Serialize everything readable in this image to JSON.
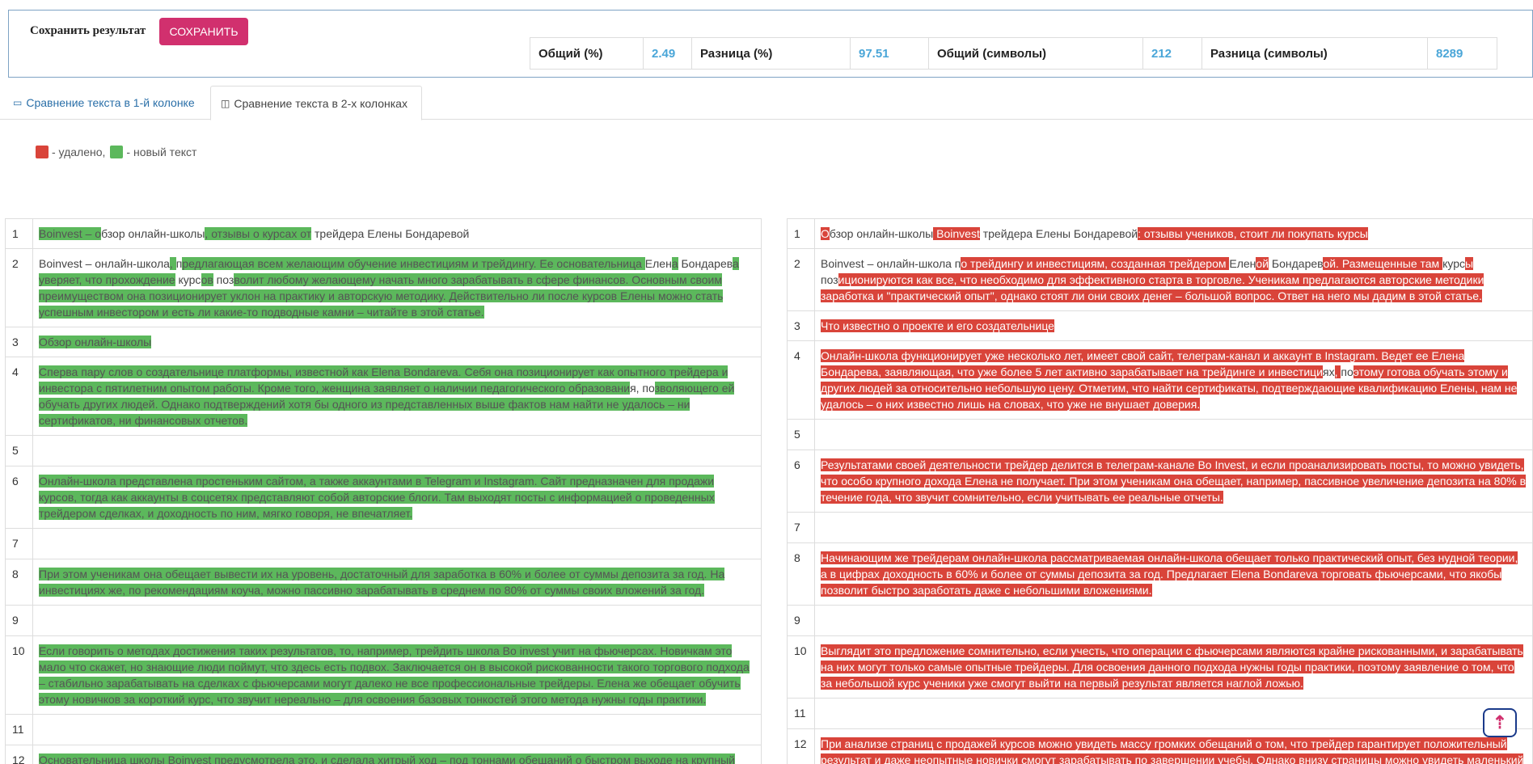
{
  "header": {
    "save_label": "Сохранить результат",
    "save_button": "СОХРАНИТЬ"
  },
  "stats": [
    {
      "label": "Общий (%)",
      "value": "2.49"
    },
    {
      "label": "Разница (%)",
      "value": "97.51"
    },
    {
      "label": "Общий (символы)",
      "value": "212"
    },
    {
      "label": "Разница (символы)",
      "value": "8289"
    }
  ],
  "tabs": {
    "one_col": "Сравнение текста в 1-й колонке",
    "two_col": "Сравнение текста в 2-х колонках"
  },
  "legend": {
    "deleted": "- удалено,",
    "new": "- новый текст"
  },
  "colors": {
    "deleted": "#d9443a",
    "new": "#5cb85c",
    "accent": "#d1306e"
  },
  "left_rows": [
    {
      "n": "1",
      "segs": [
        [
          "g",
          "Boinvest – о"
        ],
        [
          "n",
          "бзор онлайн-школы"
        ],
        [
          "g",
          ", отзывы о курсах от"
        ],
        [
          "n",
          " трейдера Елены Бондаревой"
        ]
      ]
    },
    {
      "n": "2",
      "segs": [
        [
          "n",
          "Boinvest – онлайн-школа"
        ],
        [
          "g",
          ", "
        ],
        [
          "n",
          "п"
        ],
        [
          "g",
          "редлагающая всем желающим обучение инвестициям и трейдингу. Ее основательница "
        ],
        [
          "n",
          "Елен"
        ],
        [
          "g",
          "а"
        ],
        [
          "n",
          " Бондарев"
        ],
        [
          "g",
          "а уверяет, что прохождение"
        ],
        [
          "n",
          " курс"
        ],
        [
          "g",
          "ов"
        ],
        [
          "n",
          " поз"
        ],
        [
          "g",
          "волит любому желающему начать много зарабатывать в сфере финансов. Основным своим преимуществом она позиционирует уклон на практику и авторскую методику. Действительно ли после курсов Елены можно стать успешным инвестором и есть ли какие-то подводные камни – читайте в этой статье."
        ]
      ]
    },
    {
      "n": "3",
      "segs": [
        [
          "g",
          "Обзор онлайн-школы"
        ]
      ]
    },
    {
      "n": "4",
      "segs": [
        [
          "g",
          "Сперва пару слов о создательнице платформы, известной как Elena Bondareva. Себя она позиционирует как опытного трейдера и инвестора с пятилетним опытом работы. Кроме того, женщина заявляет о наличии педагогического образовани"
        ],
        [
          "n",
          "я, по"
        ],
        [
          "g",
          "зволяющего ей обучать других людей. Однако подтверждений хотя бы одного из представленных выше фактов нам найти не удалось – ни сертификатов, ни финансовых отчетов."
        ]
      ]
    },
    {
      "n": "5",
      "segs": []
    },
    {
      "n": "6",
      "segs": [
        [
          "g",
          "Онлайн-школа представлена простеньким сайтом, а также аккаунтами в Telegram и Instagram. Сайт предназначен для продажи курсов, тогда как аккаунты в соцсетях представляют собой авторские блоги. Там выходят посты с информацией о проведенных трейдером сделках, и доходность по ним, мягко говоря, не впечатляет."
        ]
      ]
    },
    {
      "n": "7",
      "segs": []
    },
    {
      "n": "8",
      "segs": [
        [
          "g",
          "При этом ученикам она обещает вывести их на уровень, достаточный для заработка в 60% и более от суммы депозита за год. На инвестициях же, по рекомендациям коуча, можно пассивно зарабатывать в среднем по 80% от суммы своих вложений за год."
        ]
      ]
    },
    {
      "n": "9",
      "segs": []
    },
    {
      "n": "10",
      "segs": [
        [
          "g",
          "Если говорить о методах достижения таких результатов, то, например, трейдить школа Bo invest учит на фьючерсах. Новичкам это мало что скажет, но знающие люди поймут, что здесь есть подвох. Заключается он в высокой рискованности такого торгового подхода – стабильно зарабатывать на сделках с фьючерсами могут далеко не все профессиональные трейдеры. Елена же обещает обучить этому новичков за короткий курс, что звучит нереально – для освоения базовых тонкостей этого метода нужны годы практики."
        ]
      ]
    },
    {
      "n": "11",
      "segs": []
    },
    {
      "n": "12",
      "segs": [
        [
          "g",
          "Основательница школы Boinvest предусмотрела это, и сделала хитрый ход – под тоннами обещаний о быстром выходе на крупный"
        ]
      ]
    }
  ],
  "right_rows": [
    {
      "n": "1",
      "segs": [
        [
          "r",
          "О"
        ],
        [
          "n",
          "бзор онлайн-школы"
        ],
        [
          "r",
          " Boinvest"
        ],
        [
          "n",
          " трейдера Елены Бондаревой"
        ],
        [
          "r",
          ": отзывы учеников, стоит ли покупать курсы"
        ]
      ]
    },
    {
      "n": "2",
      "segs": [
        [
          "n",
          "Boinvest – онлайн-школа п"
        ],
        [
          "r",
          "о трейдингу и инвестициям, созданная трейдером "
        ],
        [
          "n",
          "Елен"
        ],
        [
          "r",
          "ой"
        ],
        [
          "n",
          " Бондарев"
        ],
        [
          "r",
          "ой. Размещенные там "
        ],
        [
          "n",
          "курс"
        ],
        [
          "r",
          "ы"
        ],
        [
          "n",
          " поз"
        ],
        [
          "r",
          "иционируются как все, что необходимо для эффективного старта в торговле. Ученикам предлагаются авторские методики заработка и \"практический опыт\", однако стоят ли они своих денег – большой вопрос. Ответ на него мы дадим в этой статье."
        ]
      ]
    },
    {
      "n": "3",
      "segs": [
        [
          "r",
          "Что известно о проекте и его создательнице"
        ]
      ]
    },
    {
      "n": "4",
      "segs": [
        [
          "r",
          "Онлайн-школа функционирует уже несколько лет, имеет свой сайт, телеграм-канал и аккаунт в Instagram. Ведет ее Елена Бондарева, заявляющая, что уже более 5 лет активно зарабатывает на трейдинге и инвестици"
        ],
        [
          "n",
          "ях"
        ],
        [
          "r",
          ", "
        ],
        [
          "n",
          "по"
        ],
        [
          "r",
          "этому готова обучать этому и других людей за относительно небольшую цену. Отметим, что найти сертификаты, подтверждающие квалификацию Елены, нам не удалось – о них известно лишь на словах, что уже не внушает доверия."
        ]
      ]
    },
    {
      "n": "5",
      "segs": []
    },
    {
      "n": "6",
      "segs": [
        [
          "r",
          "Результатами своей деятельности трейдер делится в телеграм-канале Bo Invest, и если проанализировать посты, то можно увидеть, что особо крупного дохода Елена не получает. При этом ученикам она обещает, например, пассивное увеличение депозита на 80% в течение года, что звучит сомнительно, если учитывать ее реальные отчеты."
        ]
      ]
    },
    {
      "n": "7",
      "segs": []
    },
    {
      "n": "8",
      "segs": [
        [
          "r",
          "Начинающим же трейдерам онлайн-школа рассматриваемая онлайн-школа обещает только практический опыт, без нудной теории, а в цифрах доходность в 60% и более от суммы депозита за год. Предлагает Elena Bondareva торговать фьючерсами, что якобы позволит быстро заработать даже с небольшими вложениями."
        ]
      ]
    },
    {
      "n": "9",
      "segs": []
    },
    {
      "n": "10",
      "segs": [
        [
          "r",
          "Выглядит это предложение сомнительно, если учесть, что операции с фьючерсами являются крайне рискованными, и зарабатывать на них могут только самые опытные трейдеры. Для освоения данного подхода нужны годы практики, поэтому заявление о том, что за небольшой курс ученики уже смогут выйти на первый результат является наглой ложью."
        ]
      ]
    },
    {
      "n": "11",
      "segs": []
    },
    {
      "n": "12",
      "segs": [
        [
          "r",
          "При анализе страниц с продажей курсов можно увидеть массу громких обещаний о том, что трейдер гарантирует положительный результат и даже неопытные новички смогут зарабатывать по завершении учебы. Однако внизу страницы можно увидеть маленький"
        ]
      ]
    }
  ]
}
